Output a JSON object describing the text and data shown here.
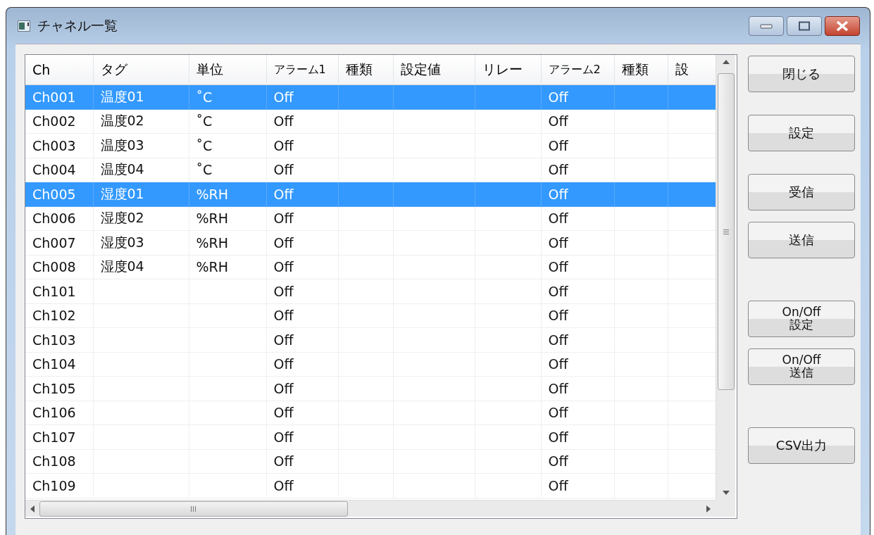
{
  "window": {
    "title": "チャネル一覧"
  },
  "table": {
    "columns": [
      "Ch",
      "タグ",
      "単位",
      "アラーム1",
      "種類",
      "設定値",
      "リレー",
      "アラーム2",
      "種類",
      "設"
    ],
    "rows": [
      {
        "ch": "Ch001",
        "tag": "温度01",
        "unit": "˚C",
        "alarm1": "Off",
        "alarm2": "Off",
        "selected": true
      },
      {
        "ch": "Ch002",
        "tag": "温度02",
        "unit": "˚C",
        "alarm1": "Off",
        "alarm2": "Off",
        "selected": false
      },
      {
        "ch": "Ch003",
        "tag": "温度03",
        "unit": "˚C",
        "alarm1": "Off",
        "alarm2": "Off",
        "selected": false
      },
      {
        "ch": "Ch004",
        "tag": "温度04",
        "unit": "˚C",
        "alarm1": "Off",
        "alarm2": "Off",
        "selected": false
      },
      {
        "ch": "Ch005",
        "tag": "湿度01",
        "unit": "%RH",
        "alarm1": "Off",
        "alarm2": "Off",
        "selected": true
      },
      {
        "ch": "Ch006",
        "tag": "湿度02",
        "unit": "%RH",
        "alarm1": "Off",
        "alarm2": "Off",
        "selected": false
      },
      {
        "ch": "Ch007",
        "tag": "湿度03",
        "unit": "%RH",
        "alarm1": "Off",
        "alarm2": "Off",
        "selected": false
      },
      {
        "ch": "Ch008",
        "tag": "湿度04",
        "unit": "%RH",
        "alarm1": "Off",
        "alarm2": "Off",
        "selected": false
      },
      {
        "ch": "Ch101",
        "alarm1": "Off",
        "alarm2": "Off",
        "selected": false
      },
      {
        "ch": "Ch102",
        "alarm1": "Off",
        "alarm2": "Off",
        "selected": false
      },
      {
        "ch": "Ch103",
        "alarm1": "Off",
        "alarm2": "Off",
        "selected": false
      },
      {
        "ch": "Ch104",
        "alarm1": "Off",
        "alarm2": "Off",
        "selected": false
      },
      {
        "ch": "Ch105",
        "alarm1": "Off",
        "alarm2": "Off",
        "selected": false
      },
      {
        "ch": "Ch106",
        "alarm1": "Off",
        "alarm2": "Off",
        "selected": false
      },
      {
        "ch": "Ch107",
        "alarm1": "Off",
        "alarm2": "Off",
        "selected": false
      },
      {
        "ch": "Ch108",
        "alarm1": "Off",
        "alarm2": "Off",
        "selected": false
      },
      {
        "ch": "Ch109",
        "alarm1": "Off",
        "alarm2": "Off",
        "selected": false
      }
    ]
  },
  "buttons": [
    {
      "label": "閉じる"
    },
    {
      "label": "設定"
    },
    {
      "label": "受信"
    },
    {
      "label": "送信"
    },
    {
      "label": "On/Off\n設定"
    },
    {
      "label": "On/Off\n送信"
    },
    {
      "label": "CSV出力"
    }
  ]
}
